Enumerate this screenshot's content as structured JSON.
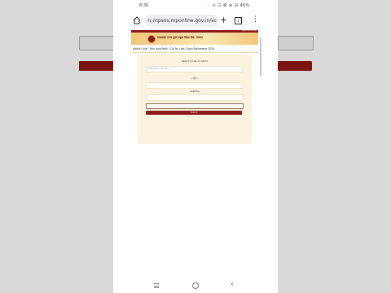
{
  "status": {
    "time": "8:36",
    "right": "·· ⊙ ⊡ ⊠ ⊕ ⊟ 46%"
  },
  "browser": {
    "url": "mpsos.mponline.gov.in/sc",
    "tabs_count": "1"
  },
  "site": {
    "org_name": "मध्यप्रदेश राज्य मुक्त स्कूल शिक्षा बोर्ड, भोपाल",
    "toplink": "Back to Home",
    "exam_title": "Admit Card - Ruk Jana Nahi / Go for Last Chain December 2024"
  },
  "form": {
    "heading": "Select mode of Admit",
    "field1_placeholder": "Application Number",
    "or_label": "-- OR --",
    "captcha_label": "Captcha",
    "submit_label": "Submit"
  }
}
